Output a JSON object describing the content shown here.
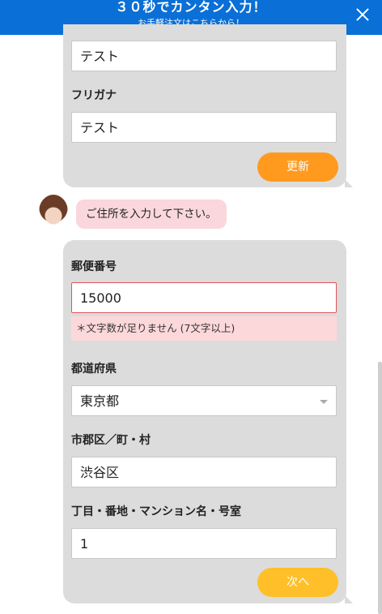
{
  "header": {
    "title": "３０秒でカンタン入力！",
    "subtitle": "お手軽注文はこちらから！"
  },
  "top_form": {
    "name_value": "テスト",
    "furigana_label": "フリガナ",
    "furigana_value": "テスト",
    "update_button": "更新"
  },
  "operator": {
    "message": "ご住所を入力して下さい。"
  },
  "address_form": {
    "postal_label": "郵便番号",
    "postal_value": "15000",
    "postal_error": "＊文字数が足りません (7文字以上)",
    "prefecture_label": "都道府県",
    "prefecture_value": "東京都",
    "city_label": "市郡区／町・村",
    "city_value": "渋谷区",
    "address_label": "丁目・番地・マンション名・号室",
    "address_value": "1",
    "next_button": "次へ"
  },
  "colors": {
    "header_bg": "#0a6fd6",
    "update_button": "#ff9a1f",
    "next_button": "#ffbf28",
    "error_border": "#e0545c",
    "error_bg": "#fdd8db"
  },
  "icons": {
    "close": "close-icon",
    "select_caret": "chevron-down-icon"
  }
}
